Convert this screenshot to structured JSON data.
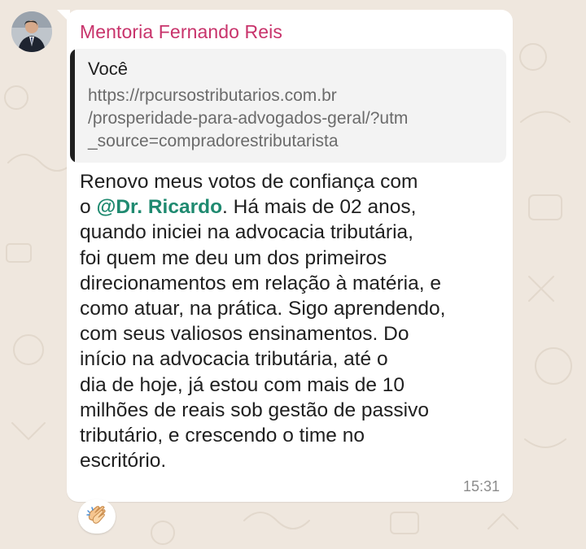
{
  "chat": {
    "sender_name": "Mentoria Fernando Reis",
    "sender_color": "#c8336b",
    "avatar_icon": "person-avatar",
    "quoted_message": {
      "author": "Você",
      "text_lines": [
        "https://rpcursostributarios.com.br",
        "/prosperidade-para-advogados-geral/?utm",
        "_source=compradorestributarista"
      ]
    },
    "message": {
      "line1": "Renovo meus votos de confiança com",
      "line2_prefix": "o ",
      "mention": "@Dr. Ricardo",
      "line2_suffix": ". Há mais de 02 anos,",
      "lines": [
        "quando iniciei na advocacia tributária,",
        "foi quem me deu um dos primeiros",
        "direcionamentos em relação à matéria, e",
        "como atuar, na prática. Sigo aprendendo,",
        "com seus valiosos ensinamentos. Do",
        "início na advocacia tributária, até o",
        "dia de hoje, já estou com mais de 10",
        "milhões de reais sob gestão de passivo",
        "tributário, e crescendo o time no",
        "escritório."
      ],
      "mention_color": "#1f8a70",
      "time": "15:31"
    },
    "reaction": {
      "icon": "clapping-hands-icon",
      "emoji": "👏"
    }
  }
}
